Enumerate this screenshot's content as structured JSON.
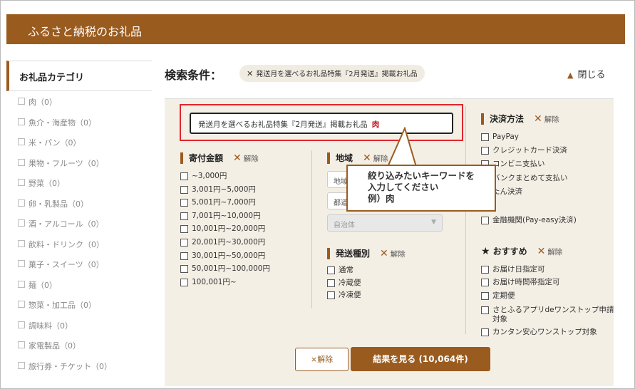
{
  "header": {
    "title": "ふるさと納税のお礼品"
  },
  "sidebar": {
    "title": "お礼品カテゴリ",
    "items": [
      {
        "label": "肉（0）"
      },
      {
        "label": "魚介・海産物（0）"
      },
      {
        "label": "米・パン（0）"
      },
      {
        "label": "果物・フルーツ（0）"
      },
      {
        "label": "野菜（0）"
      },
      {
        "label": "卵・乳製品（0）"
      },
      {
        "label": "酒・アルコール（0）"
      },
      {
        "label": "飲料・ドリンク（0）"
      },
      {
        "label": "菓子・スイーツ（0）"
      },
      {
        "label": "麺（0）"
      },
      {
        "label": "惣菜・加工品（0）"
      },
      {
        "label": "調味料（0）"
      },
      {
        "label": "家電製品（0）"
      },
      {
        "label": "旅行券・チケット（0）"
      }
    ]
  },
  "search": {
    "label": "検索条件：",
    "chip": "発送月を選べるお礼品特集『2月発送』掲載お礼品",
    "chip_close": "✕",
    "close_link": "閉じる",
    "keyword_value": "発送月を選べるお礼品特集『2月発送』掲載お礼品",
    "keyword_highlight": "肉"
  },
  "donation": {
    "title": "寄付金額",
    "clear": "解除",
    "options": [
      "~3,000円",
      "3,001円~5,000円",
      "5,001円~7,000円",
      "7,001円~10,000円",
      "10,001円~20,000円",
      "20,001円~30,000円",
      "30,001円~50,000円",
      "50,001円~100,000円",
      "100,001円~"
    ]
  },
  "region": {
    "title": "地域",
    "clear": "解除",
    "select1": "地域",
    "select2": "都道",
    "select3": "自治体"
  },
  "shipping": {
    "title": "発送種別",
    "clear": "解除",
    "options": [
      "通常",
      "冷蔵便",
      "冷凍便"
    ]
  },
  "payment": {
    "title": "決済方法",
    "clear": "解除",
    "options": [
      "PayPay",
      "クレジットカード決済",
      "コンビニ支払い",
      "ネットバンクまとめて支払い",
      "かんたん決済",
      "金融機関(Pay-easy決済)"
    ],
    "visible_partial": [
      "PayPay",
      "クレジットカード決済",
      "コンビニ支払い",
      "バンクまとめて支払い",
      "たん決済",
      "金融機関(Pay-easy決済)"
    ]
  },
  "recommend": {
    "title": "おすすめ",
    "clear": "解除",
    "options": [
      "お届け日指定可",
      "お届け時間帯指定可",
      "定期便",
      "さとふるアプリdeワンストップ申請対象",
      "カンタン安心ワンストップ対象"
    ]
  },
  "callout": {
    "line1": "絞り込みたいキーワードを",
    "line2": "入力してください",
    "line3": "例）肉"
  },
  "buttons": {
    "clear": "×解除",
    "result": "結果を見る (10,064件)"
  },
  "colors": {
    "brand": "#9a5b1f",
    "highlight": "#e0262f",
    "panel": "#f4efe5"
  }
}
